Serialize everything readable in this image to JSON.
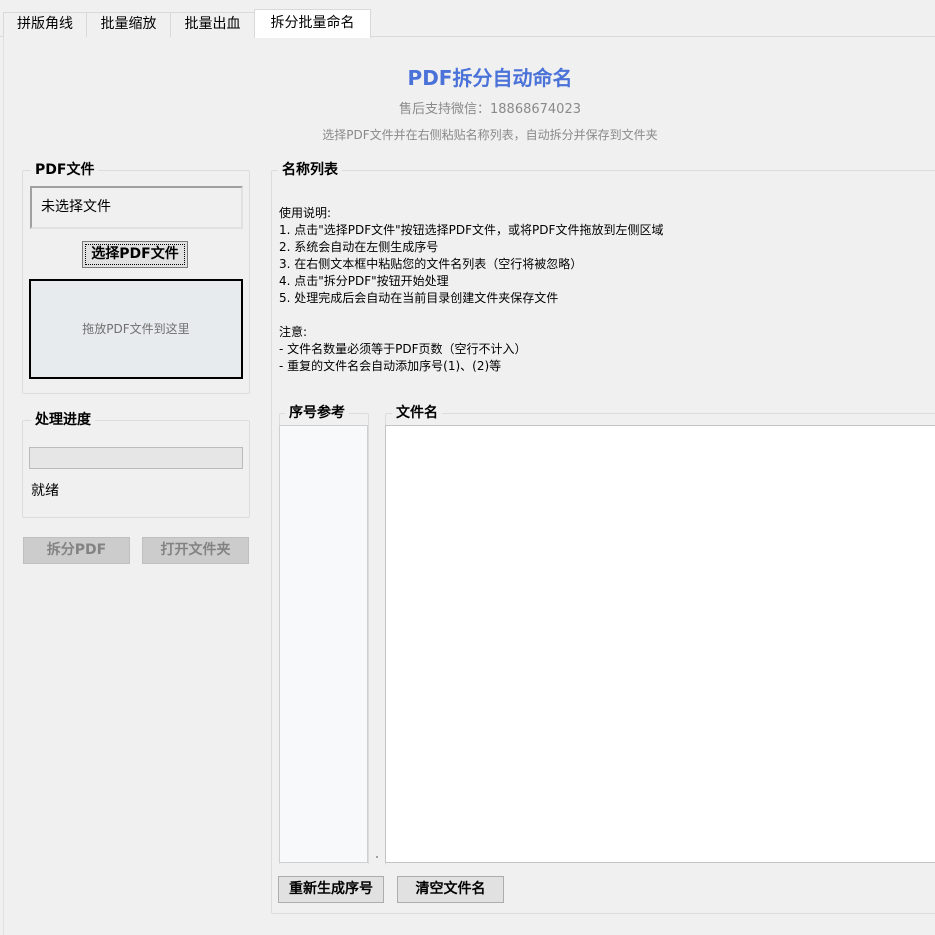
{
  "tabs": [
    {
      "label": "拼版角线"
    },
    {
      "label": "批量缩放"
    },
    {
      "label": "批量出血"
    },
    {
      "label": "拆分批量命名"
    }
  ],
  "header": {
    "title": "PDF拆分自动命名",
    "support": "售后支持微信：18868674023",
    "description": "选择PDF文件并在右侧粘贴名称列表，自动拆分并保存到文件夹"
  },
  "pdf_group": {
    "label": "PDF文件",
    "file_value": "未选择文件",
    "select_button": "选择PDF文件",
    "drop_text": "拖放PDF文件到这里"
  },
  "progress_group": {
    "label": "处理进度",
    "progress_percent": 0,
    "status": "就绪"
  },
  "actions": {
    "split_button": "拆分PDF",
    "open_folder_button": "打开文件夹"
  },
  "names_group": {
    "label": "名称列表",
    "instructions": "使用说明:\n1. 点击\"选择PDF文件\"按钮选择PDF文件，或将PDF文件拖放到左侧区域\n2. 系统会自动在左侧生成序号\n3. 在右侧文本框中粘贴您的文件名列表（空行将被忽略）\n4. 点击\"拆分PDF\"按钮开始处理\n5. 处理完成后会自动在当前目录创建文件夹保存文件\n\n注意:\n- 文件名数量必须等于PDF页数（空行不计入）\n- 重复的文件名会自动添加序号(1)、(2)等",
    "seq_label": "序号参考",
    "filename_label": "文件名",
    "regenerate_button": "重新生成序号",
    "clear_button": "清空文件名"
  }
}
